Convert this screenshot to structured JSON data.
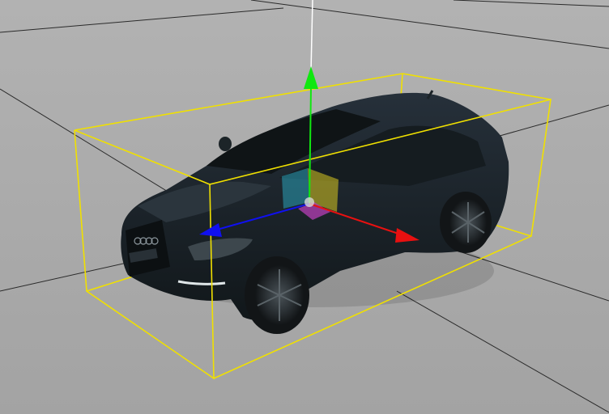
{
  "viewport": {
    "background_color": "#a3a3a3",
    "background_fade_color": "#b2b2b2"
  },
  "grid": {
    "line_color": "#2a2a2a",
    "visible": true
  },
  "selection": {
    "bounding_box_color": "#f0e000",
    "object": "car-model"
  },
  "car": {
    "body_color": "#1b2226",
    "glass_color": "#0f1416",
    "tire_color": "#161a1c",
    "rim_color": "#2c3236",
    "light_color": "#dfe6e8"
  },
  "gizmo": {
    "type": "translate",
    "x_axis_color": "#e81010",
    "y_axis_color": "#10e810",
    "z_axis_color": "#1010f0",
    "vertical_line_color": "#ffffff",
    "plane_handle_colors": [
      "#2aa0b8",
      "#d8c820",
      "#c040c0"
    ]
  }
}
